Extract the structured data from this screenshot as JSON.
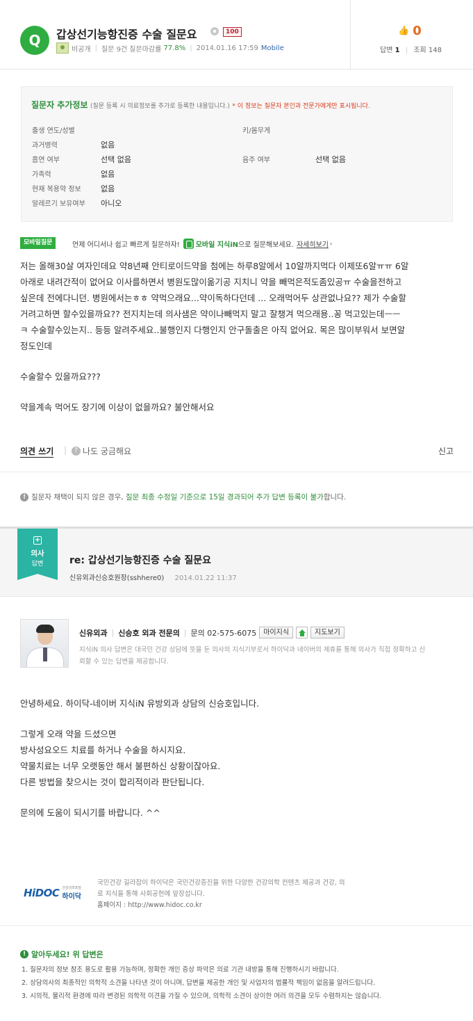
{
  "question": {
    "badge": "Q",
    "title": "갑상선기능항진증 수술 질문요",
    "level_badge": "100",
    "author": "비공개",
    "question_stats": "질문 9건 질문마감률",
    "close_rate": "77.8%",
    "datetime": "2014.01.16 17:59",
    "platform": "Mobile",
    "likes": "0",
    "answers_label": "답변",
    "answers_count": "1",
    "views_label": "조회",
    "views_count": "148"
  },
  "extra_info": {
    "title": "질문자 추가정보",
    "desc": "(질문 등록 시 의료정보를 추가로 등록한 내용입니다.)",
    "warning": "* 이 정보는 질문자 본인과 전문가에게만 표시됩니다.",
    "rows": [
      {
        "label": "출생 연도/성별",
        "value": ""
      },
      {
        "label": "과거병력",
        "value": "없음"
      },
      {
        "label": "흡연 여부",
        "value": "선택 없음"
      },
      {
        "label": "가족력",
        "value": "없음"
      },
      {
        "label": "현재 복용약 정보",
        "value": "없음"
      },
      {
        "label": "알레르기 보유여부",
        "value": "아니오"
      }
    ],
    "right_rows": [
      {
        "label": "키/몸무게",
        "value": ""
      },
      {
        "label": "음주 여부",
        "value": "선택 없음"
      }
    ]
  },
  "mobile_banner": {
    "tag": "모바일질문",
    "text1": "언제 어디서나 쉽고 빠르게 질문하자!",
    "brand": "모바일 지식iN",
    "text2": "으로 질문해보세요.",
    "link": "자세히보기"
  },
  "question_body": [
    "저는 올해30살 여자인데요 약8년째 안티로이드약을 첨에는 하루8알에서 10알까지먹다 이제또6알ㅠㅠ 6알",
    "아래로 내려간적이 없어요 이사를하면서 병원도많이옮기공 지치니 약을 빼먹은적도좀있공ㅠ 수술을전하고",
    "싶은데 전에다니던. 병원에서는ㅎㅎ 약먹으래요...약이독하다던데 ... 오래먹어두 상관없나요?? 제가 수술할",
    "거려고하면 할수있을까요?? 전지치는데 의사샘은 약이나빼먹지 말고 잘챙겨 먹으래용..꽁 먹고있는데ㅡㅡ",
    "ㅋ 수술할수있는지.. 등등 알려주세요..불행인지 다행인지 안구돌출은 아직 없어요. 목은 많이부워서 보면알",
    "정도인데",
    "",
    "수술할수 있을까요???",
    "",
    "약을계속 먹어도 장기에 이상이 없을까요? 불안해서요"
  ],
  "actions": {
    "opinion": "의견 쓰기",
    "curious": "나도 궁금해요",
    "report": "신고"
  },
  "notice": {
    "part1": "질문자 채택이 되지 않은 경우,",
    "part2": "질문 최종 수정일 기준으로 15일 경과되어 추가 답변 등록이 불가",
    "part3": "합니다."
  },
  "answer": {
    "ribbon_line1": "의사",
    "ribbon_line2": "답변",
    "title": "re: 갑상선기능항진증 수술 질문요",
    "author": "신유외과신승호원장(sshhere0)",
    "datetime": "2014.01.22 11:37",
    "doctor": {
      "dept": "신유외과",
      "name": "신승호 외과 전문의",
      "contact": "문의 02-575-6075",
      "btn_mypage": "마이지식",
      "btn_map": "지도보기",
      "desc": "지식iN 의사 답변은 대국민 건강 상담에 뜻을 둔 의사의 지식기부로서 하이닥과 네이버의 제휴를 통해 의사가 직접 정확하고 신뢰할 수 있는 답변을 제공합니다."
    },
    "body": [
      "안녕하세요. 하이닥-네이버 지식iN 유방외과 상담의 신승호입니다.",
      "",
      "그렇게 오래 약을 드셨으면",
      "방사성요오드 치료를 하거나 수술을 하시지요.",
      "약물치료는 너무 오랫동안 해서 불편하신 상황이잖아요.",
      "다른 방법을 찾으시는 것이 합리적이라 판단됩니다.",
      "",
      "문의에 도움이 되시기를 바랍니다.  ^^"
    ],
    "hidoc": {
      "logo_main": "HiDOC",
      "logo_sub_small": "건강의학포털",
      "logo_sub": "하이닥",
      "desc1": "국민건강 길라잡이 하이닥은 국민건강증진을 위한 다양한 건강의학 컨텐츠 제공과 건강, 의",
      "desc2": "료 지식을 통해 사회공헌에 앞장섭니다.",
      "homepage": "홈페이지 : http://www.hidoc.co.kr"
    }
  },
  "legal": {
    "title": "알아두세요! 위 답변은",
    "items": [
      "1.  질문자의 정보 참조 용도로 활용 가능하며, 정확한 개인 증상 파악은 의료 기관 내방을 통해 진행하시기 바랍니다.",
      "2.  상담의사의 최종적인 의학적 소견을 나타낸 것이 아니며, 답변을 제공한 개인 및 사업자의 법률적 책임이 없음을 알려드립니다.",
      "3.  시의적, 물리적 환경에 따라 변경된 의학적 이견을 가질 수 있으며, 의학적 소견이 상이한 여러 의견을 모두 수렴하지는 않습니다."
    ]
  }
}
